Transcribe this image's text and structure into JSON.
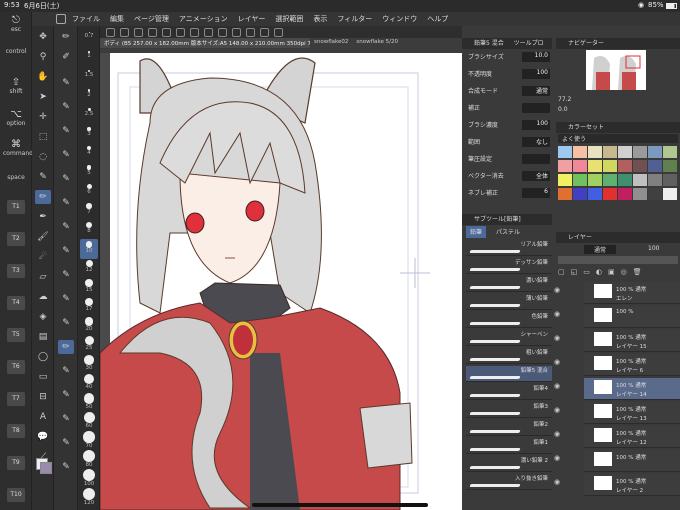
{
  "status": {
    "time": "9:53",
    "date": "6月6日(土)",
    "battery": "85%"
  },
  "menu": [
    "ファイル",
    "編集",
    "ページ管理",
    "アニメーション",
    "レイヤー",
    "選択範囲",
    "表示",
    "フィルター",
    "ウィンドウ",
    "ヘルプ"
  ],
  "edge": [
    {
      "glyph": "⎋",
      "label": "esc"
    },
    {
      "glyph": "",
      "label": "control"
    },
    {
      "glyph": "⇧",
      "label": "shift"
    },
    {
      "glyph": "⌥",
      "label": "option"
    },
    {
      "glyph": "⌘",
      "label": "command"
    },
    {
      "glyph": "",
      "label": "space"
    }
  ],
  "edge_buttons": [
    "T1",
    "T2",
    "T3",
    "T4",
    "T5",
    "T6",
    "T7",
    "T8",
    "T9",
    "T10"
  ],
  "tabs": [
    {
      "label": "ボディ (B5 257.00 x 182.00mm 版本サイズ:A5 148.00 x 210.00mm 350dpi 77.2%)",
      "active": true
    },
    {
      "label": "snowflake02",
      "active": false
    },
    {
      "label": "snowflake 5/20",
      "active": false
    }
  ],
  "size_values": [
    "0.7",
    "1",
    "1.5",
    "2",
    "2.5",
    "3",
    "4",
    "5",
    "6",
    "7",
    "8",
    "10",
    "12",
    "15",
    "17",
    "20",
    "25",
    "30",
    "40",
    "50",
    "60",
    "70",
    "80",
    "100",
    "120"
  ],
  "tool_property": {
    "title": "鉛筆5 混合",
    "tab2": "ツールプロ",
    "rows": [
      {
        "label": "ブラシサイズ",
        "value": "10.0"
      },
      {
        "label": "不透明度",
        "value": "100"
      },
      {
        "label": "合成モード",
        "value": "通常"
      },
      {
        "label": "補正",
        "value": ""
      },
      {
        "label": "ブラシ濃度",
        "value": "100"
      },
      {
        "label": "範囲",
        "value": "なし"
      },
      {
        "label": "筆圧設定",
        "value": ""
      },
      {
        "label": "ベクター消去",
        "value": "全体"
      },
      {
        "label": "ネブレ補正",
        "value": "6"
      }
    ]
  },
  "subtool": {
    "title": "サブツール[鉛筆]",
    "tabs": [
      "鉛筆",
      "パステル"
    ],
    "brushes": [
      "リアル鉛筆",
      "デッサン鉛筆",
      "濃い鉛筆",
      "薄い鉛筆",
      "色鉛筆",
      "シャーペン",
      "粗い鉛筆",
      "鉛筆5 混合",
      "鉛筆4",
      "鉛筆3",
      "鉛筆2",
      "鉛筆1",
      "濃い鉛筆 2",
      "入り抜き鉛筆"
    ],
    "selected_index": 7
  },
  "navigator": {
    "title": "ナビゲーター",
    "zoom": "77.2",
    "angle": "0.0"
  },
  "colorset": {
    "title": "カラーセット",
    "set_name": "よく使う",
    "colors": [
      "#9ec8f0",
      "#f4c1a4",
      "#e8e2c0",
      "#c8b890",
      "#d0d0d0",
      "#9a9a9a",
      "#7a9ac0",
      "#b0c890",
      "#f0a0a0",
      "#f08898",
      "#e8e070",
      "#d0d860",
      "#b06060",
      "#705050",
      "#506090",
      "#608050",
      "#f0f060",
      "#70c060",
      "#a0d060",
      "#60b070",
      "#409070",
      "#c0c0c0",
      "#808080",
      "#606060",
      "#e07030",
      "#4040c0",
      "#4060e0",
      "#e03030",
      "#c02060",
      "#909090",
      "#404040",
      "#eeeeee"
    ]
  },
  "layers": {
    "title": "レイヤー",
    "blend": "通常",
    "opacity": "100",
    "rows": [
      {
        "name": "エレン",
        "info": "100 % 通常",
        "sel": false
      },
      {
        "name": "",
        "info": "100 %",
        "sel": false
      },
      {
        "name": "レイヤー 15",
        "info": "100 % 通常",
        "sel": false
      },
      {
        "name": "レイヤー 6",
        "info": "100 % 通常",
        "sel": false
      },
      {
        "name": "レイヤー 14",
        "info": "100 % 通常",
        "sel": true
      },
      {
        "name": "レイヤー 13",
        "info": "100 % 通常",
        "sel": false
      },
      {
        "name": "レイヤー 12",
        "info": "100 % 通常",
        "sel": false
      },
      {
        "name": "",
        "info": "100 % 通常",
        "sel": false
      },
      {
        "name": "レイヤー 2",
        "info": "100 % 通常",
        "sel": false
      }
    ]
  }
}
